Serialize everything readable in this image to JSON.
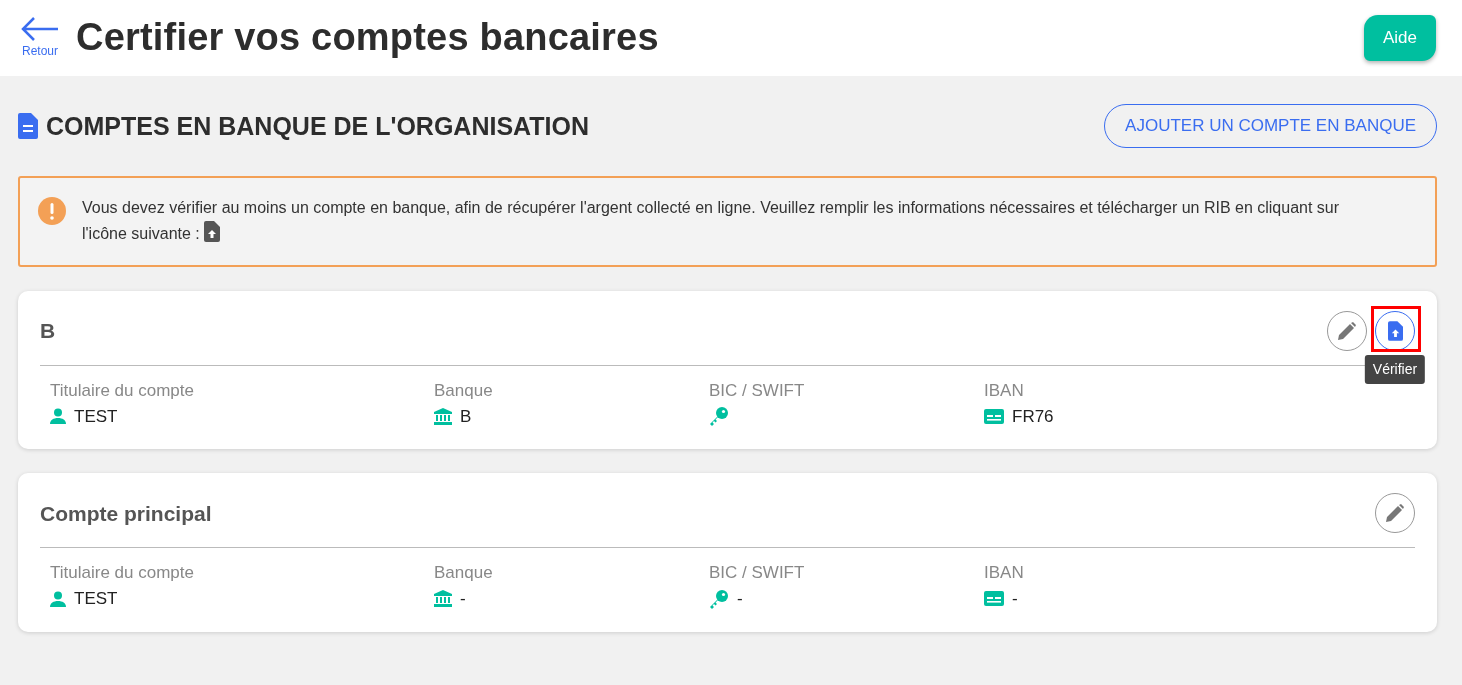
{
  "header": {
    "back_label": "Retour",
    "title": "Certifier vos comptes bancaires",
    "help_button": "Aide"
  },
  "section": {
    "title": "COMPTES EN BANQUE DE L'ORGANISATION",
    "add_button": "AJOUTER UN COMPTE EN BANQUE"
  },
  "alert": {
    "text": "Vous devez vérifier au moins un compte en banque, afin de récupérer l'argent collecté en ligne. Veuillez remplir les informations nécessaires et télécharger un RIB en cliquant sur l'icône suivante :"
  },
  "accounts": [
    {
      "name": "B",
      "actions": [
        {
          "kind": "edit",
          "highlighted": false
        },
        {
          "kind": "verify",
          "highlighted": true,
          "tooltip": "Vérifier"
        }
      ],
      "fields": [
        {
          "kind": "holder",
          "label": "Titulaire du compte",
          "value": "TEST"
        },
        {
          "kind": "bank",
          "label": "Banque",
          "value": "B"
        },
        {
          "kind": "bic",
          "label": "BIC / SWIFT"
        },
        {
          "kind": "iban",
          "label": "IBAN",
          "value": "FR76"
        }
      ]
    },
    {
      "name": "Compte principal",
      "actions": [
        {
          "kind": "edit",
          "highlighted": false
        }
      ],
      "fields": [
        {
          "kind": "holder",
          "label": "Titulaire du compte",
          "value": "TEST"
        },
        {
          "kind": "bank",
          "label": "Banque",
          "value": "-"
        },
        {
          "kind": "bic",
          "label": "BIC / SWIFT",
          "value": "-"
        },
        {
          "kind": "iban",
          "label": "IBAN",
          "value": "-"
        }
      ]
    }
  ]
}
